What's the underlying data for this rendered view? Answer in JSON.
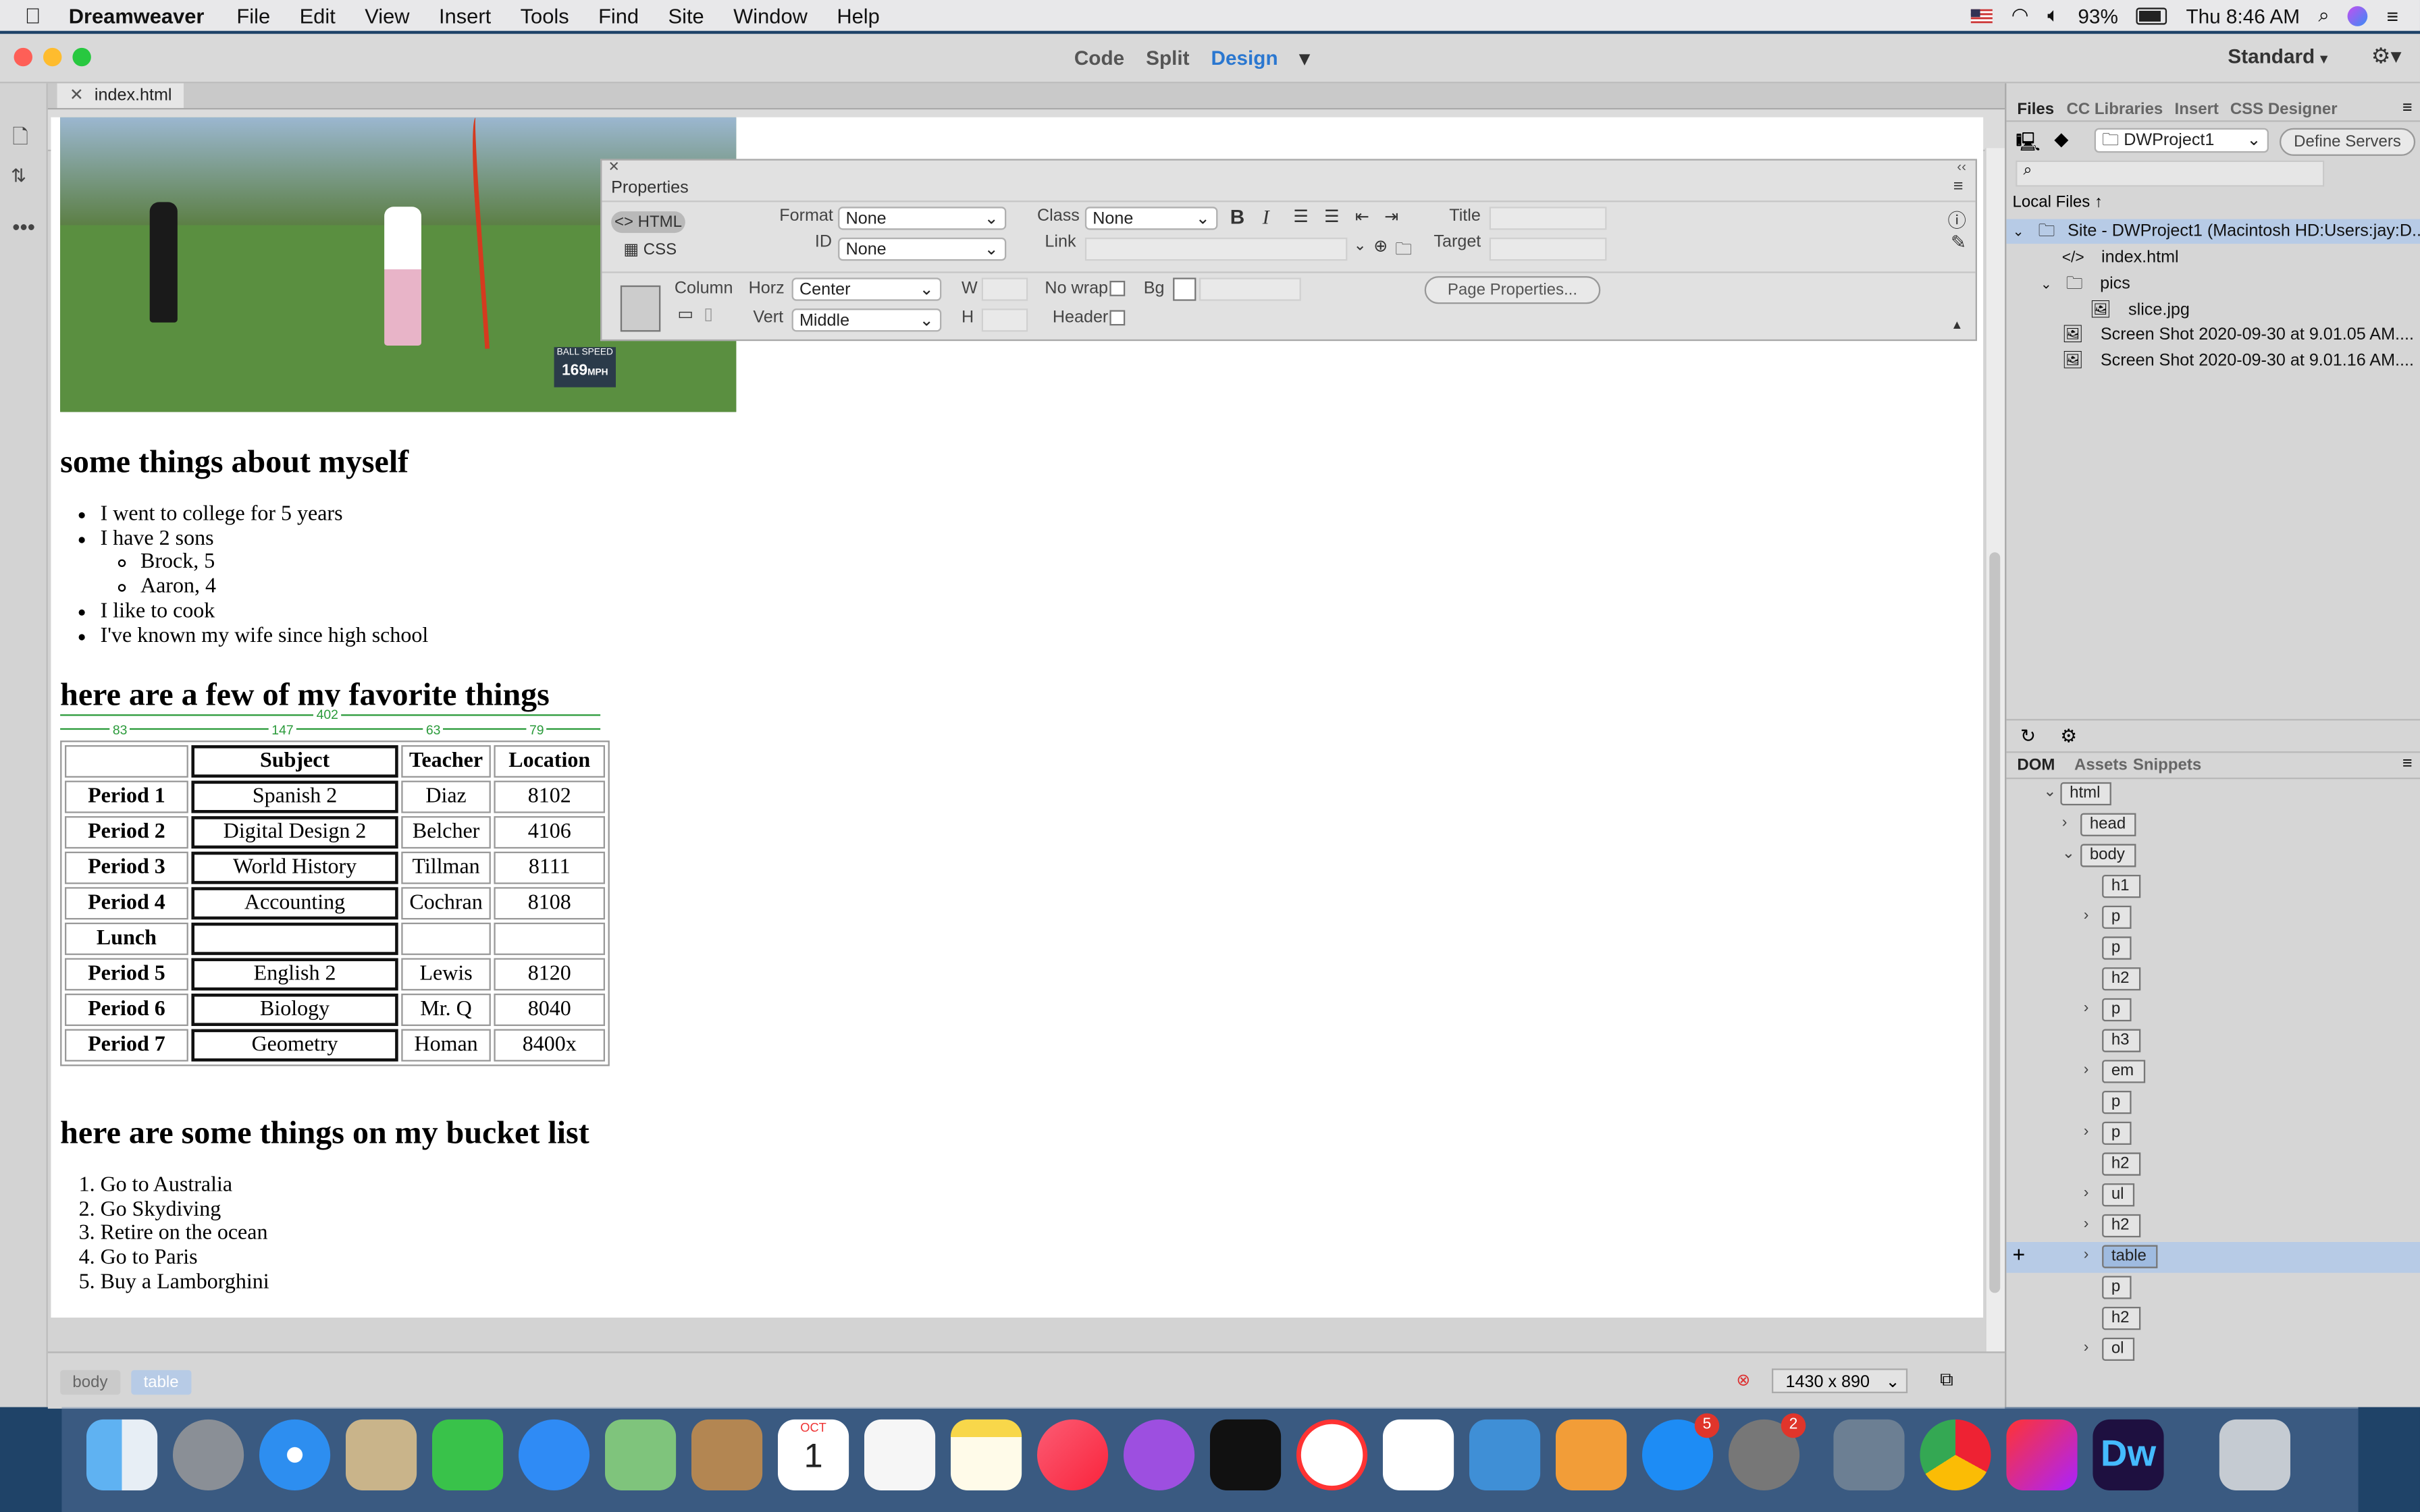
{
  "menubar": {
    "app_name": "Dreamweaver",
    "items": [
      "File",
      "Edit",
      "View",
      "Insert",
      "Tools",
      "Find",
      "Site",
      "Window",
      "Help"
    ],
    "battery": "93%",
    "clock": "Thu 8:46 AM"
  },
  "titlebar": {
    "views": [
      "Code",
      "Split",
      "Design"
    ],
    "active_view": "Design",
    "workspace": "Standard"
  },
  "document": {
    "tab": "index.html",
    "heading1": "some things about myself",
    "list1": [
      "I went to college for 5 years",
      "I have 2 sons",
      "I like to cook",
      "I've known my wife since high school"
    ],
    "sons": [
      "Brock, 5",
      "Aaron, 4"
    ],
    "heading2": "here are a few of my favorite things",
    "table_ruler": {
      "total": "402",
      "cols": [
        "83",
        "147",
        "63",
        "79"
      ]
    },
    "table": {
      "headers": [
        "",
        "Subject",
        "Teacher",
        "Location"
      ],
      "rows": [
        [
          "Period 1",
          "Spanish 2",
          "Diaz",
          "8102"
        ],
        [
          "Period 2",
          "Digital Design 2",
          "Belcher",
          "4106"
        ],
        [
          "Period 3",
          "World History",
          "Tillman",
          "8111"
        ],
        [
          "Period 4",
          "Accounting",
          "Cochran",
          "8108"
        ],
        [
          "Lunch",
          "",
          "",
          ""
        ],
        [
          "Period 5",
          "English 2",
          "Lewis",
          "8120"
        ],
        [
          "Period 6",
          "Biology",
          "Mr. Q",
          "8040"
        ],
        [
          "Period 7",
          "Geometry",
          "Homan",
          "8400x"
        ]
      ]
    },
    "heading3": "here are some things on my bucket list",
    "bucket": [
      "Go to Australia",
      "Go Skydiving",
      "Retire on the ocean",
      "Go to Paris",
      "Buy a Lamborghini"
    ],
    "photo_overlay": {
      "label": "BALL SPEED",
      "value": "169",
      "unit": "MPH"
    }
  },
  "properties": {
    "title": "Properties",
    "html_btn": "HTML",
    "css_btn": "CSS",
    "format_label": "Format",
    "format_value": "None",
    "id_label": "ID",
    "id_value": "None",
    "class_label": "Class",
    "class_value": "None",
    "link_label": "Link",
    "title_label": "Title",
    "target_label": "Target",
    "column_label": "Column",
    "horz_label": "Horz",
    "horz_value": "Center",
    "vert_label": "Vert",
    "vert_value": "Middle",
    "w_label": "W",
    "h_label": "H",
    "nowrap_label": "No wrap",
    "bg_label": "Bg",
    "header_label": "Header",
    "page_props": "Page Properties..."
  },
  "statusbar": {
    "crumbs": [
      "body",
      "table"
    ],
    "size": "1430 x 890"
  },
  "files_panel": {
    "tabs": [
      "Files",
      "CC Libraries",
      "Insert",
      "CSS Designer"
    ],
    "site": "DWProject1",
    "define_servers": "Define Servers",
    "local_files": "Local Files",
    "tree": [
      "Site - DWProject1 (Macintosh HD:Users:jay:D...",
      "index.html",
      "pics",
      "slice.jpg",
      "Screen Shot 2020-09-30 at 9.01.05 AM....",
      "Screen Shot 2020-09-30 at 9.01.16 AM...."
    ]
  },
  "dom_panel": {
    "tabs": [
      "DOM",
      "Assets",
      "Snippets"
    ],
    "nodes": [
      "html",
      "head",
      "body",
      "h1",
      "p",
      "p",
      "h2",
      "p",
      "h3",
      "em",
      "p",
      "p",
      "h2",
      "ul",
      "h2",
      "table",
      "p",
      "h2",
      "ol"
    ]
  },
  "dock": {
    "badges": {
      "appstore": "5",
      "prefs": "2"
    },
    "calendar": {
      "month": "OCT",
      "day": "1"
    }
  },
  "colors": {
    "accent": "#2a77d0",
    "selection": "#b7cbe6",
    "dom_selected": "#9fbbe0"
  }
}
